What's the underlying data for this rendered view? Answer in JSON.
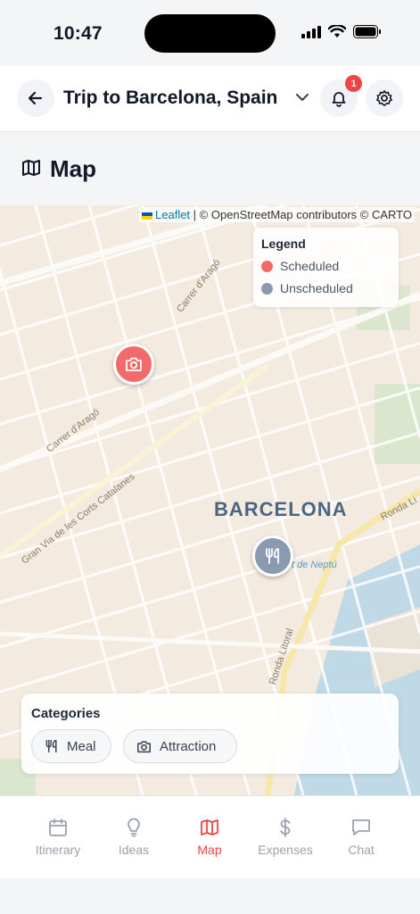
{
  "status_bar": {
    "time": "10:47"
  },
  "header": {
    "title": "Trip to Barcelona, Spain",
    "notification_count": "1"
  },
  "section": {
    "title": "Map",
    "icon": "map-icon"
  },
  "map": {
    "attribution": {
      "leaflet": "Leaflet",
      "rest": " | © OpenStreetMap contributors © CARTO"
    },
    "legend": {
      "title": "Legend",
      "items": [
        {
          "label": "Scheduled",
          "color": "#f26a6a"
        },
        {
          "label": "Unscheduled",
          "color": "#8a9ab1"
        }
      ]
    },
    "markers": [
      {
        "status": "Scheduled",
        "icon": "camera-icon"
      },
      {
        "status": "Unscheduled",
        "icon": "utensils-icon"
      }
    ],
    "labels": {
      "city": "BARCELONA",
      "streets": [
        "Carrer d'Aragó",
        "Carrer d'Aragó",
        "Gran Via de les Corts Catalanes",
        "Ronda Litoral",
        "Ronda Li"
      ],
      "poi": "t de Neptú"
    },
    "categories": {
      "title": "Categories",
      "items": [
        {
          "label": "Meal",
          "icon": "utensils-icon"
        },
        {
          "label": "Attraction",
          "icon": "camera-icon"
        }
      ]
    }
  },
  "nav": {
    "active": "Map",
    "accent": "#ef4444",
    "items": [
      {
        "label": "Itinerary",
        "icon": "calendar-icon"
      },
      {
        "label": "Ideas",
        "icon": "lightbulb-icon"
      },
      {
        "label": "Map",
        "icon": "map-icon"
      },
      {
        "label": "Expenses",
        "icon": "dollar-icon"
      },
      {
        "label": "Chat",
        "icon": "chat-icon"
      }
    ]
  }
}
